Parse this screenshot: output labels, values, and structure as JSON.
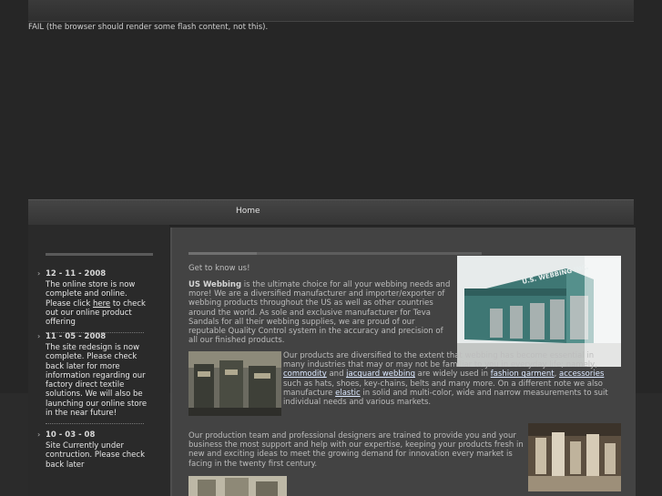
{
  "fallback_message": "FAIL (the browser should render some flash content, not this).",
  "nav": {
    "home_label": "Home"
  },
  "news": [
    {
      "date": "12 - 11 - 2008",
      "text_before": "The online store is now complete and online. Please click ",
      "link": "here",
      "text_after": " to check out our online product offering"
    },
    {
      "date": "11 - 05 - 2008",
      "text": "The site redesign is now complete. Please check back later for more information regarding our factory direct textile solutions. We will also be launching our online store in the near future!"
    },
    {
      "date": "10 - 03 - 08",
      "text": "Site Currently under contruction. Please check back later"
    }
  ],
  "main": {
    "heading": "Get to know us!",
    "intro_bold": "US Webbing",
    "intro_text": " is the ultimate choice for all your webbing needs and more! We are a diversified manufacturer and importer/exporter of webbing products throughout the US as well as other countries around the world. As sole and exclusive manufacturer for Teva Sandals for all their webbing supplies, we are proud of our reputable Quality Control system in the accuracy and precision of all our finished products.",
    "products": {
      "t1": "Our products are diversified to the extent that webbing has become essential in many industries that may or may not be familiar to you in everyday life; namely, ",
      "l1": "commodity",
      "t2": " and ",
      "l2": "jacquard webbing",
      "t3": " are widely used in ",
      "l3": "fashion garment",
      "t4": ", ",
      "l4": "accessories",
      "t5": " such as hats, shoes, key-chains, belts and many more. On a different note we also manufacture ",
      "l5": "elastic",
      "t6": " in solid and multi-color, wide and narrow measurements to suit individual needs and various markets."
    },
    "production_text": "Our production team and professional designers are trained to provide you and your business the most support and help with our expertise, keeping your products fresh in new and exciting ideas to meet the growing demand for innovation every market is facing in the twenty first century.",
    "building_sign": "U.S. WEBBING INC."
  },
  "colors": {
    "background": "#262626",
    "content_panel": "#434343",
    "link": "#dbe8ff"
  }
}
